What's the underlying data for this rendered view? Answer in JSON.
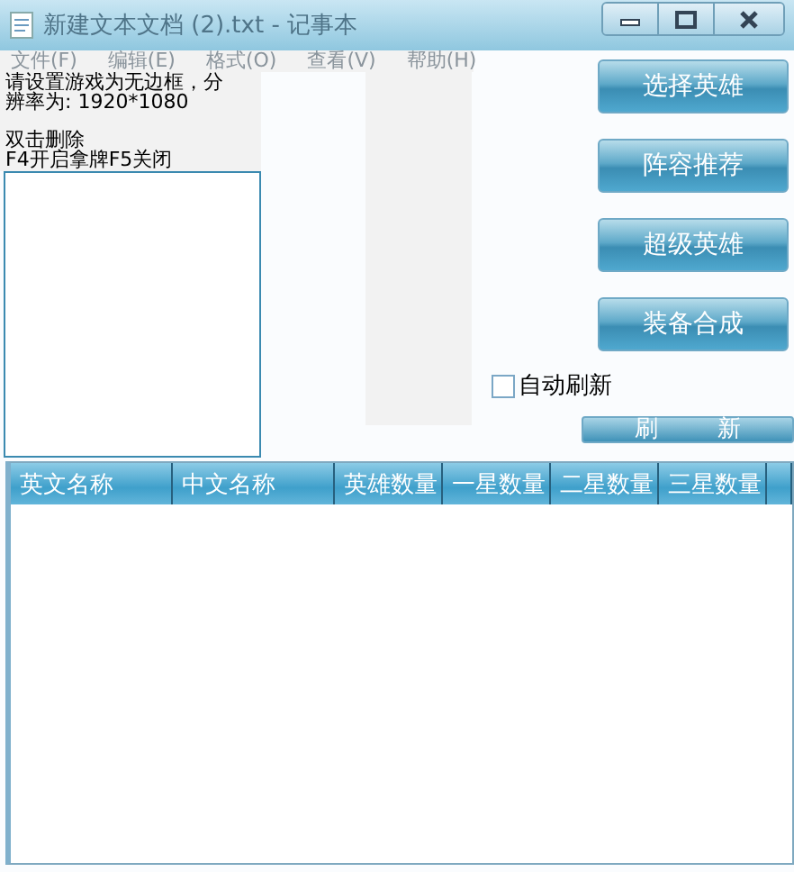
{
  "window": {
    "title": "新建文本文档 (2).txt - 记事本"
  },
  "menu": [
    "文件(F)",
    "编辑(E)",
    "格式(O)",
    "查看(V)",
    "帮助(H)"
  ],
  "notes": [
    [
      "请设置游戏为无边框，分",
      "辨率为: 1920*1080"
    ],
    [
      "双击删除",
      "F4开启拿牌F5关闭"
    ]
  ],
  "buttons": [
    "选择英雄",
    "阵容推荐",
    "超级英雄",
    "装备合成"
  ],
  "auto_refresh": {
    "label": "自动刷新",
    "checked": false
  },
  "refresh_button": "刷        新",
  "table": {
    "columns": [
      "英文名称",
      "中文名称",
      "英雄数量",
      "一星数量",
      "二星数量",
      "三星数量"
    ]
  }
}
